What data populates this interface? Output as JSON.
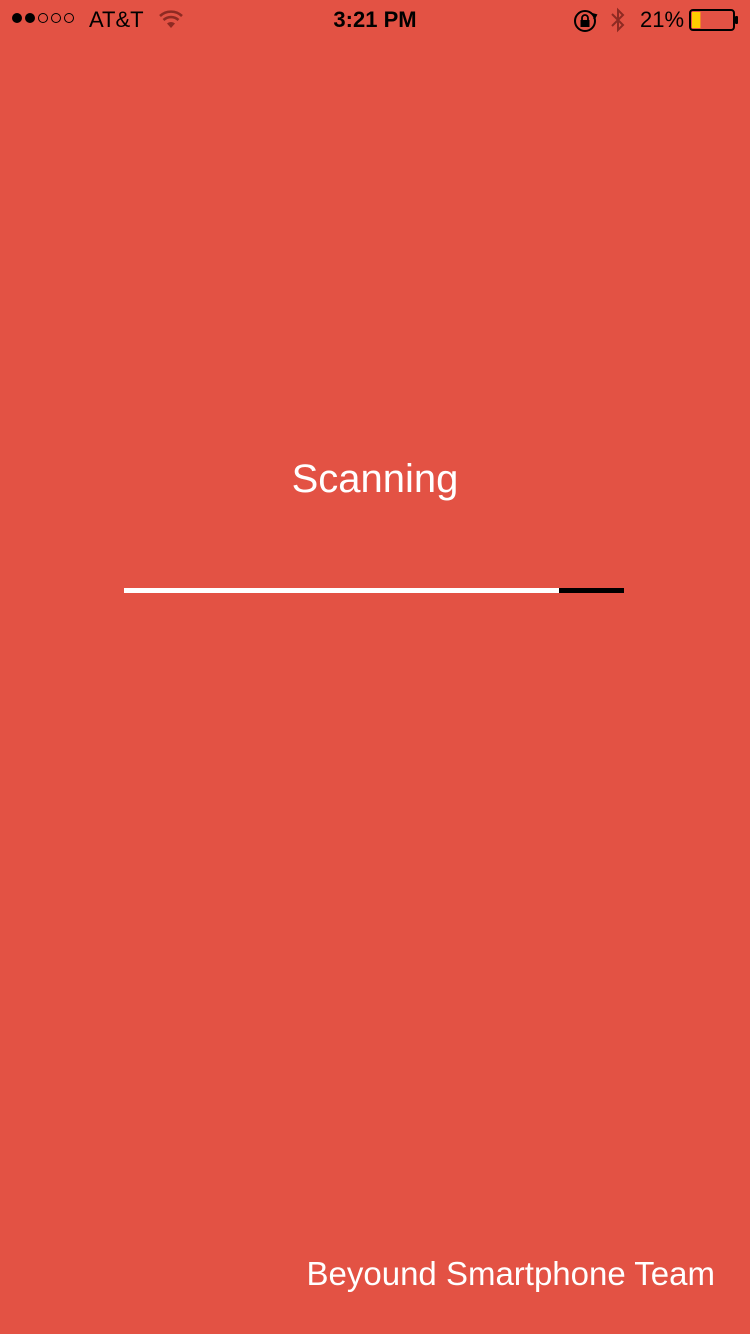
{
  "status_bar": {
    "signal_strength": {
      "filled": 2,
      "total": 5
    },
    "carrier": "AT&T",
    "time": "3:21 PM",
    "battery_percent": "21%",
    "battery_level": 0.21,
    "battery_color": "#FFCC00"
  },
  "main": {
    "title": "Scanning",
    "progress": 0.87
  },
  "footer": {
    "text": "Beyound Smartphone Team"
  },
  "colors": {
    "background": "#E35244",
    "progress_track": "#000000",
    "progress_fill": "#FFFFFF"
  }
}
